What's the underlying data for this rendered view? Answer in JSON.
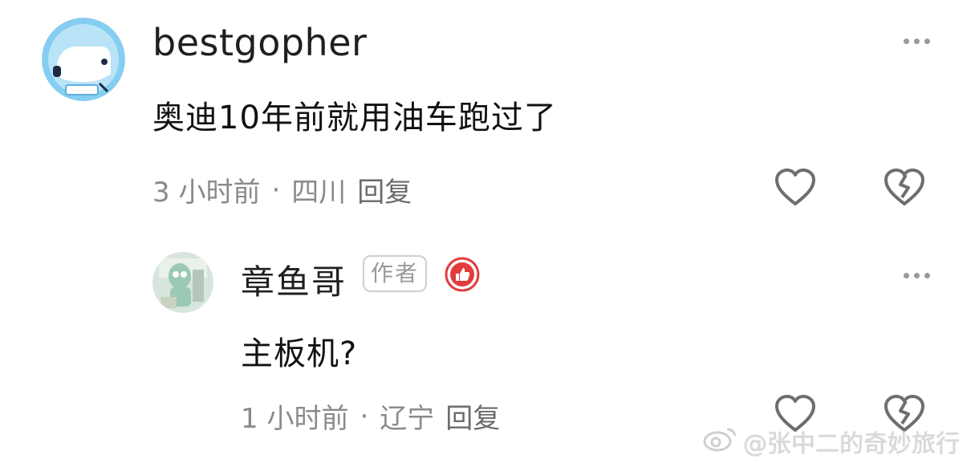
{
  "comment": {
    "username": "bestgopher",
    "text": "奥迪10年前就用油车跑过了",
    "time": "3 小时前",
    "separator": "·",
    "location": "四川",
    "reply_label": "回复"
  },
  "reply": {
    "username": "章鱼哥",
    "author_badge": "作者",
    "text": "主板机?",
    "time": "1 小时前",
    "separator": "·",
    "location": "辽宁",
    "reply_label": "回复"
  },
  "watermark": {
    "text": "@张中二的奇妙旅行"
  },
  "colors": {
    "avatar1_bg": "#7fcaf0",
    "avatar2_bg": "#cfe0d8",
    "badge_red": "#e33b3b",
    "meta_gray": "#8a8a8a",
    "icon_gray": "#6e6e6e"
  }
}
